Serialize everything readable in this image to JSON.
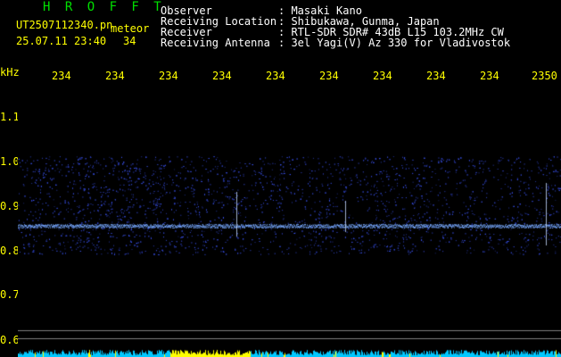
{
  "app": {
    "title": "H R O F F T"
  },
  "file": {
    "name": "UT2507112340.pn",
    "mode": "meteor",
    "datetime": "25.07.11 23:40",
    "minute_label": "34"
  },
  "meta": {
    "labels": [
      "Observer",
      "Receiving Location",
      "Receiver",
      "Receiving Antenna"
    ],
    "values": [
      ": Masaki Kano",
      ": Shibukawa, Gunma, Japan",
      ": RTL-SDR SDR# 43dB L15 103.2MHz CW",
      ": 3el Yagi(V) Az 330 for Vladivostok"
    ]
  },
  "axis": {
    "unit": "kHz",
    "x_ticks": [
      "234",
      "234",
      "234",
      "234",
      "234",
      "234",
      "234",
      "234",
      "234",
      "2350"
    ],
    "y_ticks": [
      "1.1",
      "1.0",
      "0.9",
      "0.8",
      "0.7",
      "0.6"
    ]
  },
  "colors": {
    "background": "#000000",
    "header_text": "#ffffff",
    "axis_text": "#ffff00",
    "title_text": "#00e000",
    "signal_band": "#5a8cff",
    "noise_dots": "#1a3cff",
    "bottom_trace": "#00c8ff",
    "bottom_trace_hi": "#ffff00"
  }
}
